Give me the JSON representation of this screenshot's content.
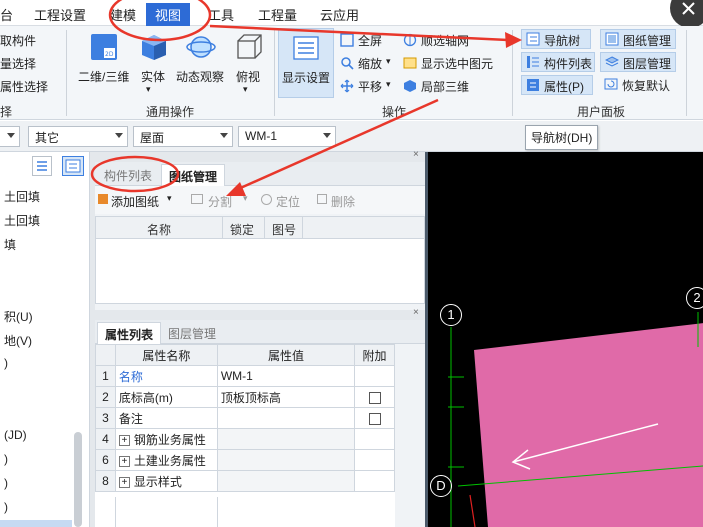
{
  "menu": {
    "items": [
      "台",
      "工程设置",
      "建模",
      "视图",
      "工具",
      "工程量",
      "云应用"
    ],
    "active_index": 3
  },
  "ribbon": {
    "left_items": [
      "取构件",
      "量选择",
      "属性选择"
    ],
    "left_group": "择",
    "view_buttons": [
      "二维/三维",
      "实体",
      "动态观察",
      "俯视"
    ],
    "view_group": "通用操作",
    "display_settings": "显示设置",
    "ops_items": [
      "全屏",
      "缩放",
      "平移",
      "顺选轴网",
      "显示选中图元",
      "局部三维"
    ],
    "ops_group": "操作",
    "user_panel": [
      "导航树",
      "图纸管理",
      "构件列表",
      "图层管理",
      "属性(P)",
      "恢复默认"
    ],
    "user_group": "用户面板",
    "tooltip": "导航树(DH)"
  },
  "toolbar": {
    "combos": [
      "其它",
      "屋面",
      "WM-1"
    ]
  },
  "tree": {
    "items": [
      "土回填",
      "土回填",
      "填",
      "积(U)",
      "地(V)",
      ")",
      "(JD)",
      ")",
      ")",
      ")"
    ]
  },
  "upper_panel": {
    "tabs": [
      "构件列表",
      "图纸管理"
    ],
    "actions": [
      "添加图纸",
      "分割",
      "定位",
      "删除"
    ],
    "headers": [
      "名称",
      "锁定",
      "图号"
    ]
  },
  "lower_panel": {
    "tabs": [
      "属性列表",
      "图层管理"
    ],
    "headers": [
      "属性名称",
      "属性值",
      "附加"
    ],
    "rows": [
      {
        "num": "1",
        "name": "名称",
        "value": "WM-1",
        "check": false
      },
      {
        "num": "2",
        "name": "底标高(m)",
        "value": "顶板顶标高",
        "check": true
      },
      {
        "num": "3",
        "name": "备注",
        "value": "",
        "check": true
      },
      {
        "num": "4",
        "name": "钢筋业务属性",
        "value": "",
        "check": false,
        "expand": true
      },
      {
        "num": "6",
        "name": "土建业务属性",
        "value": "",
        "check": false,
        "expand": true
      },
      {
        "num": "8",
        "name": "显示样式",
        "value": "",
        "check": false,
        "expand": true
      }
    ]
  },
  "canvas": {
    "axis_labels": [
      "1",
      "2",
      "D"
    ],
    "colors": {
      "background": "#000000",
      "slab": "#e06aa8",
      "axis": "#00c000"
    }
  },
  "colors": {
    "accent": "#2d6bd6",
    "annotation": "#e8372b"
  }
}
